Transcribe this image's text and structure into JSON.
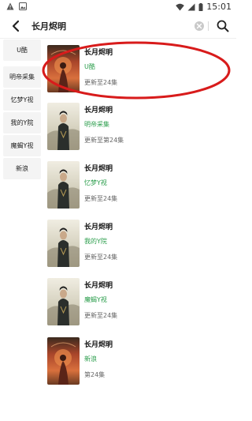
{
  "status_bar": {
    "time": "15:01",
    "icons_left": [
      "alert-icon",
      "image-icon"
    ],
    "icons_right": [
      "wifi-icon",
      "signal-icon",
      "battery-icon"
    ]
  },
  "search": {
    "query": "长月烬明",
    "icons": [
      "back-icon",
      "clear-icon",
      "search-icon"
    ]
  },
  "sidebar": {
    "items": [
      {
        "label": "U酷"
      },
      {
        "label": "明帝采集"
      },
      {
        "label": "忆梦Y视"
      },
      {
        "label": "我的Y院"
      },
      {
        "label": "魔蝎Y视"
      },
      {
        "label": "新浪"
      }
    ]
  },
  "results": [
    {
      "title": "长月烬明",
      "source": "U酷",
      "status": "更新至24集",
      "poster_style": "red-fire"
    },
    {
      "title": "长月烬明",
      "source": "明帝采集",
      "status": "更新至第24集",
      "poster_style": "dark-warrior"
    },
    {
      "title": "长月烬明",
      "source": "忆梦Y视",
      "status": "更新至24集",
      "poster_style": "dark-warrior"
    },
    {
      "title": "长月烬明",
      "source": "我的Y院",
      "status": "更新至24集",
      "poster_style": "dark-warrior"
    },
    {
      "title": "长月烬明",
      "source": "魔蝎Y视",
      "status": "更新至24集",
      "poster_style": "dark-warrior"
    },
    {
      "title": "长月烬明",
      "source": "新浪",
      "status": "第24集",
      "poster_style": "red-fire"
    }
  ],
  "colors": {
    "source_green": "#2a9d4b",
    "sidebar_bg": "#f4f4f4",
    "annotation_red": "#d81b1b"
  }
}
